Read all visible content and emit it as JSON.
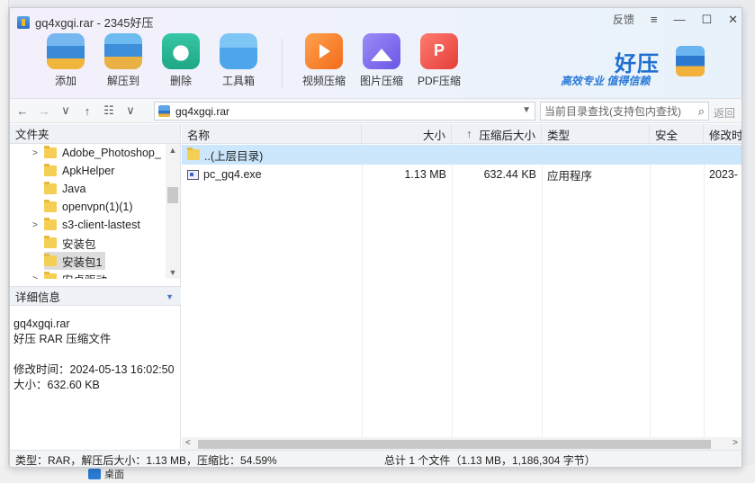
{
  "window": {
    "title": "gq4xgqi.rar - 2345好压",
    "feedback": "反馈",
    "controls": {
      "menu": "≡",
      "minimize": "—",
      "maximize": "☐",
      "close": "✕"
    }
  },
  "toolbar": {
    "add": "添加",
    "extract": "解压到",
    "delete": "删除",
    "toolbox": "工具箱",
    "video": "视频压缩",
    "image": "图片压缩",
    "pdf": "PDF压缩"
  },
  "brand": {
    "name": "好压",
    "slogan": "高效专业 值得信赖"
  },
  "nav": {
    "back": "←",
    "forward": "→",
    "history": "∨",
    "up": "↑",
    "view": "☷",
    "view_drop": "∨",
    "path": "gq4xgqi.rar",
    "path_drop": "▼",
    "search_placeholder": "当前目录查找(支持包内查找)",
    "search_icon": "magnifier-icon",
    "return_label": "返回"
  },
  "folders_pane": {
    "header": "文件夹",
    "items": [
      {
        "label": "Adobe_Photoshop_",
        "expandable": true
      },
      {
        "label": "ApkHelper",
        "expandable": false
      },
      {
        "label": "Java",
        "expandable": false
      },
      {
        "label": "openvpn(1)(1)",
        "expandable": false
      },
      {
        "label": "s3-client-lastest",
        "expandable": true
      },
      {
        "label": "安装包",
        "expandable": false
      },
      {
        "label": "安装包1",
        "expandable": false,
        "selected": true
      },
      {
        "label": "安卓驱动",
        "expandable": true
      }
    ]
  },
  "details_pane": {
    "header": "详细信息",
    "filename": "gq4xgqi.rar",
    "filetype": "好压 RAR 压缩文件",
    "modified": "修改时间：2024-05-13 16:02:50",
    "size": "大小：632.60 KB"
  },
  "file_list": {
    "columns": {
      "name": "名称",
      "size": "大小",
      "packed": "压缩后大小",
      "type": "类型",
      "security": "安全",
      "modified": "修改时"
    },
    "sort_indicator": "↑",
    "rows": [
      {
        "name": "..(上层目录)",
        "size": "",
        "packed": "",
        "type": "",
        "security": "",
        "modified": ""
      },
      {
        "name": "pc_gq4.exe",
        "size": "1.13 MB",
        "packed": "632.44 KB",
        "type": "应用程序",
        "security": "",
        "modified": "2023-"
      }
    ]
  },
  "status": {
    "left": "类型：RAR，解压后大小：1.13 MB，压缩比：54.59%",
    "right": "总计 1 个文件（1.13 MB，1,186,304 字节）"
  },
  "background": {
    "partial_label": "桌面"
  }
}
